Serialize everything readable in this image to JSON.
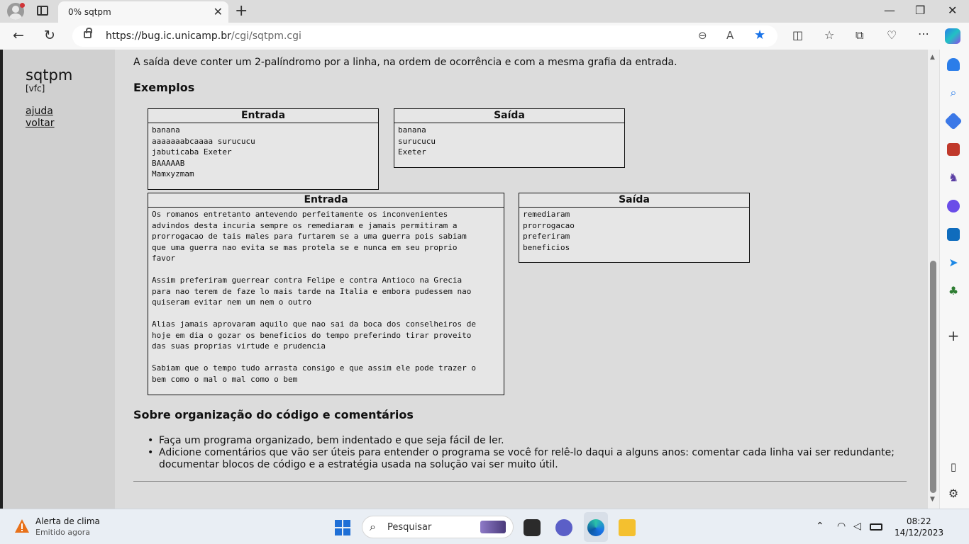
{
  "browser": {
    "tab_title": "0%  sqtpm",
    "tab_close": "✕",
    "new_tab": "+",
    "url_host": "https://bug.ic.unicamp.br",
    "url_path": "/cgi/sqtpm.cgi",
    "window_controls": {
      "minimize": "—",
      "maximize": "❐",
      "close": "✕"
    }
  },
  "sidebar_nav": {
    "brand": "sqtpm",
    "subtitle": "[vfc]",
    "links": [
      "ajuda",
      "voltar"
    ]
  },
  "content": {
    "intro": "A saída deve conter um 2-palíndromo por a linha, na ordem de ocorrência e com a mesma grafia da entrada.",
    "examples_heading": "Exemplos",
    "example1": {
      "input_header": "Entrada",
      "input_text": "banana\naaaaaaabcaaaa surucucu\njabuticaba Exeter\nBAAAAAB\nMamxyzmam",
      "output_header": "Saída",
      "output_text": "banana\nsurucucu\nExeter"
    },
    "example2": {
      "input_header": "Entrada",
      "input_text": "Os romanos entretanto antevendo perfeitamente os inconvenientes\nadvindos desta incuria sempre os remediaram e jamais permitiram a\nprorrogacao de tais males para furtarem se a uma guerra pois sabiam\nque uma guerra nao evita se mas protela se e nunca em seu proprio\nfavor\n\nAssim preferiram guerrear contra Felipe e contra Antioco na Grecia\npara nao terem de faze lo mais tarde na Italia e embora pudessem nao\nquiseram evitar nem um nem o outro\n\nAlias jamais aprovaram aquilo que nao sai da boca dos conselheiros de\nhoje em dia o gozar os beneficios do tempo preferindo tirar proveito\ndas suas proprias virtude e prudencia\n\nSabiam que o tempo tudo arrasta consigo e que assim ele pode trazer o\nbem como o mal o mal como o bem",
      "output_header": "Saída",
      "output_text": "remediaram\nprorrogacao\npreferiram\nbeneficios"
    },
    "org_heading": "Sobre organização do código e comentários",
    "org_items": [
      "Faça um programa organizado, bem indentado e que seja fácil de ler.",
      "Adicione comentários que vão ser úteis para entender o programa se você for relê-lo daqui a alguns anos: comentar cada linha vai ser redundante; documentar blocos de código e a estratégia usada na solução vai ser muito útil."
    ]
  },
  "taskbar": {
    "weather_title": "Alerta de clima",
    "weather_sub": "Emitido agora",
    "search_placeholder": "Pesquisar",
    "time": "08:22",
    "date": "14/12/2023"
  }
}
